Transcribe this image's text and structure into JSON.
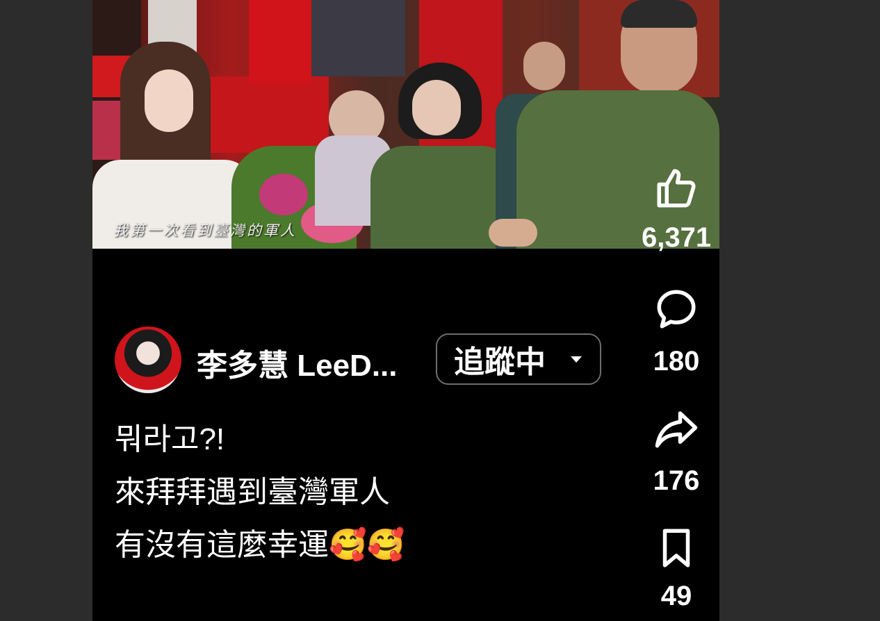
{
  "video": {
    "subtitle": "我第一次看到臺灣的軍人"
  },
  "channel": {
    "name": "李多慧 LeeD...",
    "follow_label": "追蹤中"
  },
  "caption": {
    "lines": [
      "뭐라고?!",
      "來拜拜遇到臺灣軍人",
      "有沒有這麼幸運🥰🥰"
    ]
  },
  "actions": {
    "like": {
      "icon": "thumbs-up-icon",
      "count": "6,371"
    },
    "comment": {
      "icon": "comment-bubble-icon",
      "count": "180"
    },
    "share": {
      "icon": "share-arrow-icon",
      "count": "176"
    },
    "save": {
      "icon": "bookmark-icon",
      "count": "49"
    }
  },
  "colors": {
    "background": "#000000",
    "gutter": "#2c2c2c",
    "button_border": "#6d6d6d"
  }
}
